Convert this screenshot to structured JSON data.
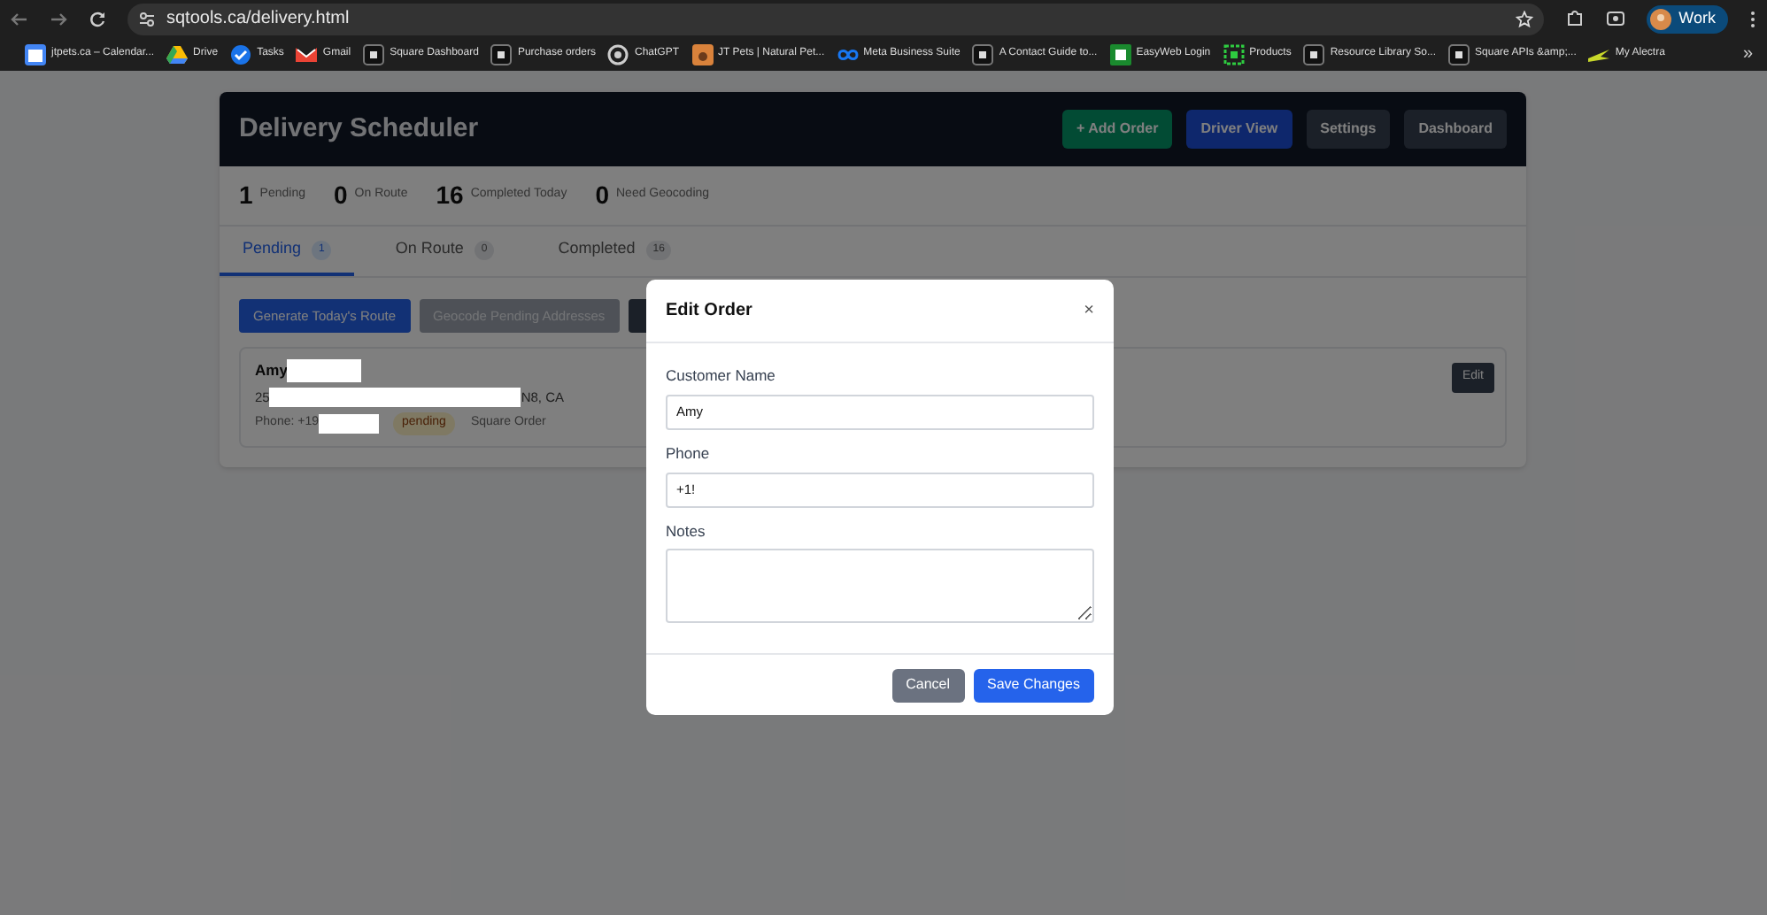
{
  "browser": {
    "url": "sqtools.ca/delivery.html",
    "profile": "Work",
    "bookmarks": [
      {
        "label": "jtpets.ca – Calendar...",
        "kind": "calendar"
      },
      {
        "label": "Drive",
        "kind": "drive"
      },
      {
        "label": "Tasks",
        "kind": "tasks"
      },
      {
        "label": "Gmail",
        "kind": "gmail"
      },
      {
        "label": "Square Dashboard",
        "kind": "square"
      },
      {
        "label": "Purchase orders",
        "kind": "square"
      },
      {
        "label": "ChatGPT",
        "kind": "chatgpt"
      },
      {
        "label": "JT Pets | Natural Pet...",
        "kind": "pets"
      },
      {
        "label": "Meta Business Suite",
        "kind": "meta"
      },
      {
        "label": "A Contact Guide to...",
        "kind": "square"
      },
      {
        "label": "EasyWeb Login",
        "kind": "td"
      },
      {
        "label": "Products",
        "kind": "products"
      },
      {
        "label": "Resource Library So...",
        "kind": "square"
      },
      {
        "label": "Square APIs &amp;...",
        "kind": "square"
      },
      {
        "label": "My Alectra",
        "kind": "alectra"
      }
    ],
    "overflow": "»"
  },
  "app": {
    "title": "Delivery Scheduler",
    "header_buttons": [
      {
        "label": "+ Add Order",
        "kind": "green"
      },
      {
        "label": "Driver View",
        "kind": "blue"
      },
      {
        "label": "Settings",
        "kind": "dark"
      },
      {
        "label": "Dashboard",
        "kind": "dark"
      }
    ],
    "stats": [
      {
        "value": "1",
        "label": "Pending"
      },
      {
        "value": "0",
        "label": "On Route"
      },
      {
        "value": "16",
        "label": "Completed Today"
      },
      {
        "value": "0",
        "label": "Need Geocoding"
      }
    ],
    "tabs": [
      {
        "label": "Pending",
        "count": "1",
        "selected": true
      },
      {
        "label": "On Route",
        "count": "0",
        "selected": false
      },
      {
        "label": "Completed",
        "count": "16",
        "selected": false
      }
    ],
    "actions": [
      {
        "label": "Generate Today's Route",
        "kind": "primary"
      },
      {
        "label": "Geocode Pending Addresses",
        "kind": "disabled"
      },
      {
        "kind": "dark"
      }
    ],
    "orders": [
      {
        "name": "Amy",
        "address_start": "25",
        "address_end": "N8, CA",
        "phone": "Phone: +19",
        "status": "pending",
        "source": "Square Order",
        "edit": "Edit"
      }
    ]
  },
  "modal": {
    "title": "Edit Order",
    "close": "×",
    "fields": [
      {
        "label": "Customer Name",
        "value": "Amy",
        "kind": "input"
      },
      {
        "label": "Phone",
        "value": "+1!",
        "kind": "input"
      },
      {
        "label": "Notes",
        "kind": "textarea"
      }
    ],
    "buttons": [
      {
        "label": "Cancel",
        "kind": "secondary"
      },
      {
        "label": "Save Changes",
        "kind": "primary"
      }
    ]
  }
}
